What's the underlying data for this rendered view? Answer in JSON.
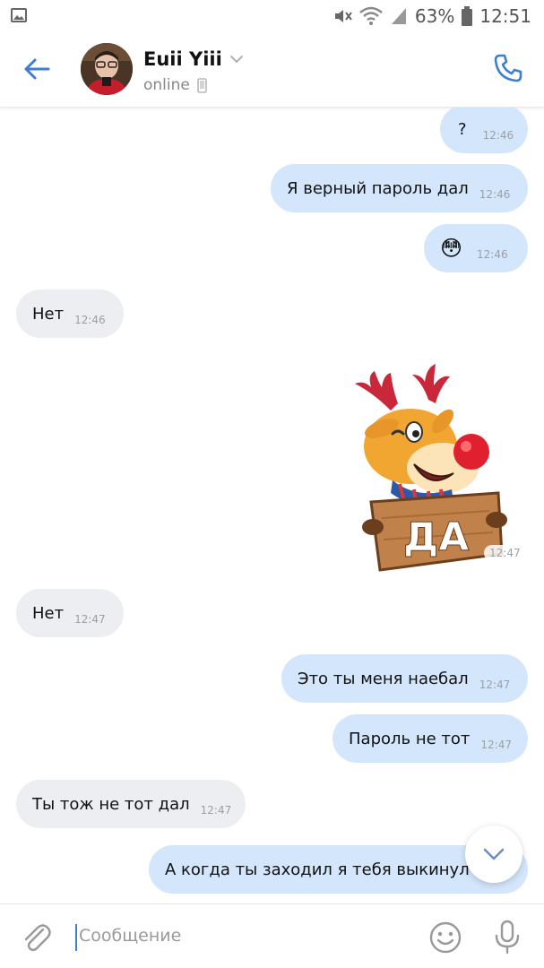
{
  "status_bar": {
    "battery": "63%",
    "time": "12:51"
  },
  "header": {
    "contact_name": "Euii Yiii",
    "status": "online"
  },
  "messages": [
    {
      "dir": "out",
      "text": "?",
      "time": "12:46"
    },
    {
      "dir": "out",
      "text": "Я верный пароль дал",
      "time": "12:46"
    },
    {
      "dir": "out",
      "text": "😳",
      "time": "12:46"
    },
    {
      "dir": "in",
      "text": "Нет",
      "time": "12:46"
    },
    {
      "dir": "out",
      "sticker_caption": "ДА",
      "time": "12:47"
    },
    {
      "dir": "in",
      "text": "Нет",
      "time": "12:47"
    },
    {
      "dir": "out",
      "text": "Это ты меня наебал",
      "time": "12:47"
    },
    {
      "dir": "out",
      "text": "Пароль не тот",
      "time": "12:47"
    },
    {
      "dir": "in",
      "text": "Ты тож не тот дал",
      "time": "12:47"
    },
    {
      "dir": "out",
      "text": "А когда ты заходил я тебя выкинул"
    }
  ],
  "composer": {
    "placeholder": "Сообщение"
  },
  "colors": {
    "accent": "#3f7fd1",
    "outgoing_bubble": "#d4e6fb",
    "incoming_bubble": "#eceef1"
  }
}
